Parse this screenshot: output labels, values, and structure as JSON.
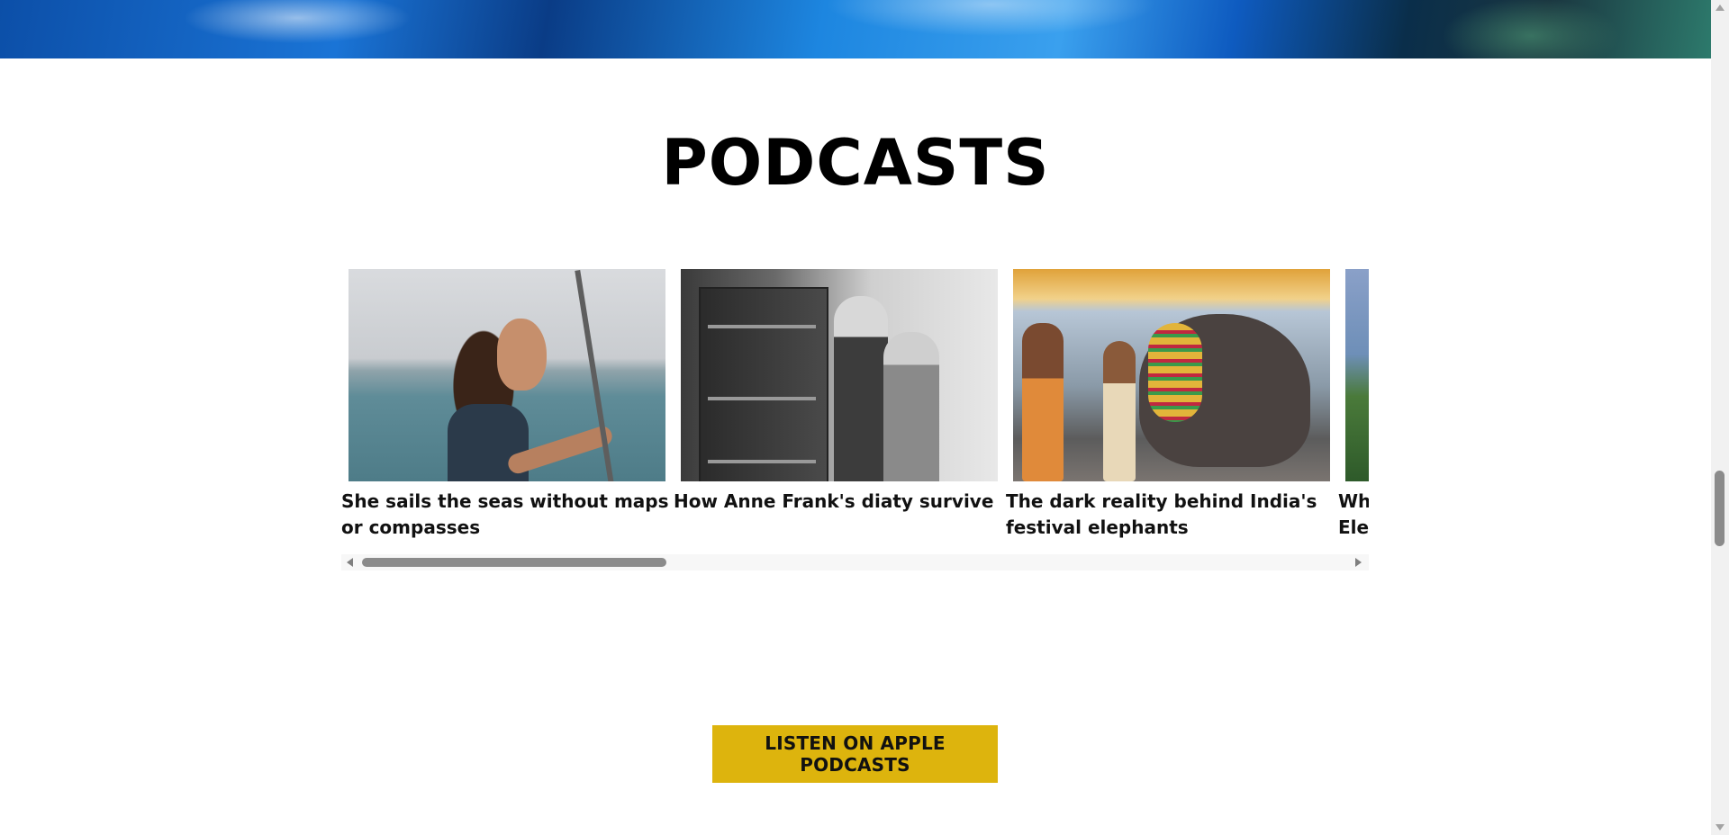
{
  "section": {
    "title": "PODCASTS"
  },
  "podcasts": [
    {
      "title": "She sails the seas without maps or compasses",
      "image": "woman-on-sailboat"
    },
    {
      "title": "How Anne Frank's diaty survive",
      "image": "two-people-by-bookcase"
    },
    {
      "title": "The dark reality behind India's festival elephants",
      "image": "decorated-elephant"
    },
    {
      "title": "Wh… Ele…",
      "image": "landscape"
    }
  ],
  "cta": {
    "label": "LISTEN ON APPLE PODCASTS",
    "color": "#ddb40d"
  },
  "carousel_scroll": {
    "position_fraction": 0.0,
    "visible_fraction": 0.3
  },
  "page_scroll": {
    "position_fraction": 0.6
  }
}
